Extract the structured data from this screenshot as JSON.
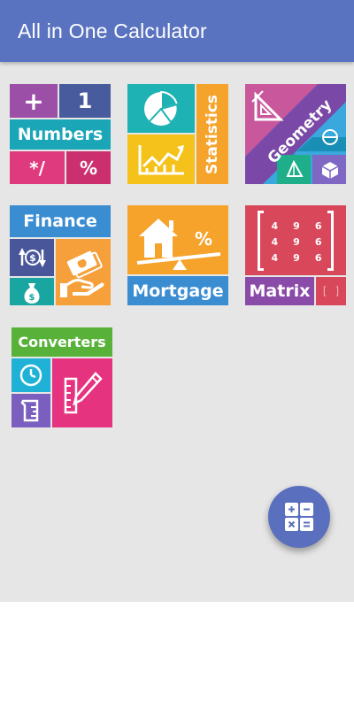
{
  "app": {
    "title": "All in One Calculator"
  },
  "colors": {
    "appbar": "#5a73c0",
    "background": "#e6e6e6",
    "fab": "#5a6fbd"
  },
  "tiles": {
    "numbers": {
      "label": "Numbers",
      "plus": "+",
      "one": "1",
      "muldiv": "*/",
      "percent": "%"
    },
    "statistics": {
      "label": "Statistics",
      "icons": [
        "pie-chart-icon",
        "line-chart-icon"
      ]
    },
    "geometry": {
      "label": "Geometry",
      "icons": [
        "set-square-icon",
        "circle-icon",
        "pyramid-icon",
        "cube-icon"
      ]
    },
    "finance": {
      "label": "Finance",
      "icons": [
        "dollar-exchange-icon",
        "money-hand-icon",
        "money-bag-icon"
      ]
    },
    "mortgage": {
      "label": "Mortgage",
      "percent": "%",
      "icons": [
        "house-balance-icon"
      ]
    },
    "matrix": {
      "label": "Matrix",
      "brackets": "[ ]",
      "values": [
        [
          "4",
          "9",
          "6"
        ],
        [
          "4",
          "9",
          "6"
        ],
        [
          "4",
          "9",
          "6"
        ]
      ]
    },
    "converters": {
      "label": "Converters",
      "icons": [
        "clock-icon",
        "beaker-icon",
        "ruler-pencil-icon"
      ]
    }
  },
  "fab": {
    "icon": "calculator-icon"
  }
}
